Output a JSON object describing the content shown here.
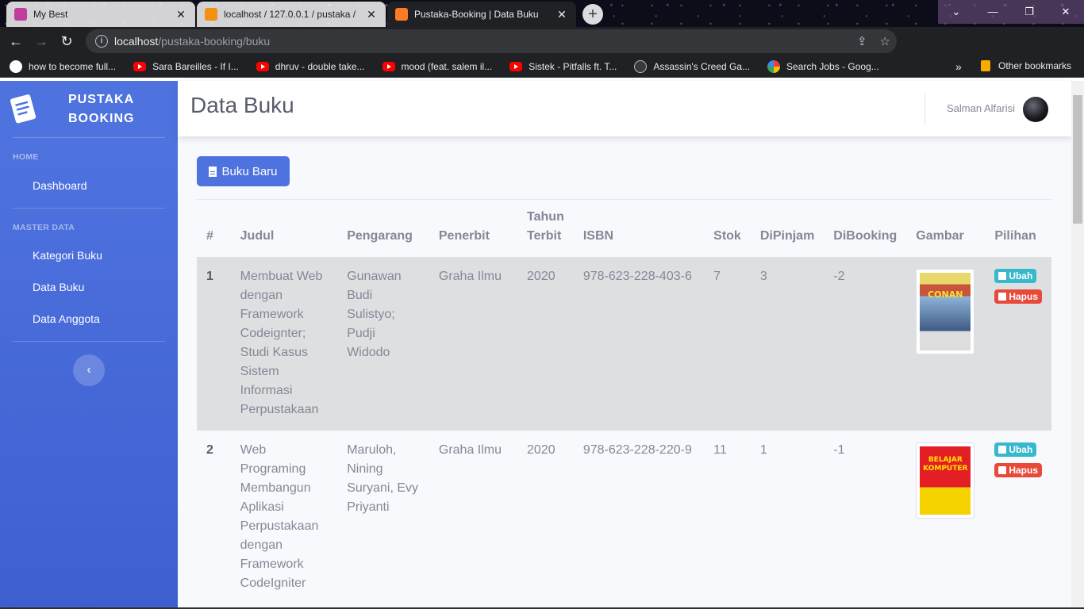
{
  "browser": {
    "tabs": [
      {
        "title": "My Best",
        "icon": "figma-icon"
      },
      {
        "title": "localhost / 127.0.0.1 / pustaka / ",
        "icon": "phpmyadmin-icon"
      },
      {
        "title": "Pustaka-Booking | Data Buku",
        "icon": "xampp-icon"
      }
    ],
    "url_host": "localhost",
    "url_path": "/pustaka-booking/buku",
    "bookmarks": [
      {
        "label": "how to become full...",
        "icon": "globe-icon"
      },
      {
        "label": "Sara Bareilles - If I...",
        "icon": "youtube-icon"
      },
      {
        "label": "dhruv - double take...",
        "icon": "youtube-icon"
      },
      {
        "label": "mood (feat. salem il...",
        "icon": "youtube-icon"
      },
      {
        "label": "Sistek - Pitfalls ft. T...",
        "icon": "youtube-icon"
      },
      {
        "label": "Assassin's Creed Ga...",
        "icon": "assassins-creed-icon"
      },
      {
        "label": "Search Jobs - Goog...",
        "icon": "google-icon"
      }
    ],
    "more_bookmarks": "»",
    "other_bookmarks": "Other bookmarks"
  },
  "sidebar": {
    "brand_line1": "PUSTAKA",
    "brand_line2": "BOOKING",
    "heading_home": "HOME",
    "dashboard": "Dashboard",
    "heading_master": "MASTER DATA",
    "items": [
      "Kategori Buku",
      "Data Buku",
      "Data Anggota"
    ],
    "toggle": "‹"
  },
  "topbar": {
    "title": "Data Buku",
    "user_name": "Salman Alfarisi"
  },
  "main": {
    "new_button": "Buku Baru",
    "headers": [
      "#",
      "Judul",
      "Pengarang",
      "Penerbit",
      "Tahun Terbit",
      "ISBN",
      "Stok",
      "DiPinjam",
      "DiBooking",
      "Gambar",
      "Pilihan"
    ],
    "rows": [
      {
        "no": "1",
        "judul": "Membuat Web dengan Framework Codeignter; Studi Kasus Sistem Informasi Perpustakaan",
        "pengarang": "Gunawan Budi Sulistyo; Pudji Widodo",
        "penerbit": "Graha Ilmu",
        "tahun": "2020",
        "isbn": "978-623-228-403-6",
        "stok": "7",
        "dipinjam": "3",
        "dibooking": "-2",
        "cover_text": "CONAN"
      },
      {
        "no": "2",
        "judul": "Web Programing Membangun Aplikasi Perpustakaan dengan Framework CodeIgniter",
        "pengarang": "Maruloh, Nining Suryani, Evy Priyanti",
        "penerbit": "Graha Ilmu",
        "tahun": "2020",
        "isbn": "978-623-228-220-9",
        "stok": "11",
        "dipinjam": "1",
        "dibooking": "-1",
        "cover_text": "BELAJAR KOMPUTER"
      }
    ],
    "edit_label": "Ubah",
    "delete_label": "Hapus"
  },
  "colors": {
    "primary": "#4e73df",
    "info": "#36b9cc",
    "danger": "#e74a3b",
    "text_muted": "#858796"
  }
}
